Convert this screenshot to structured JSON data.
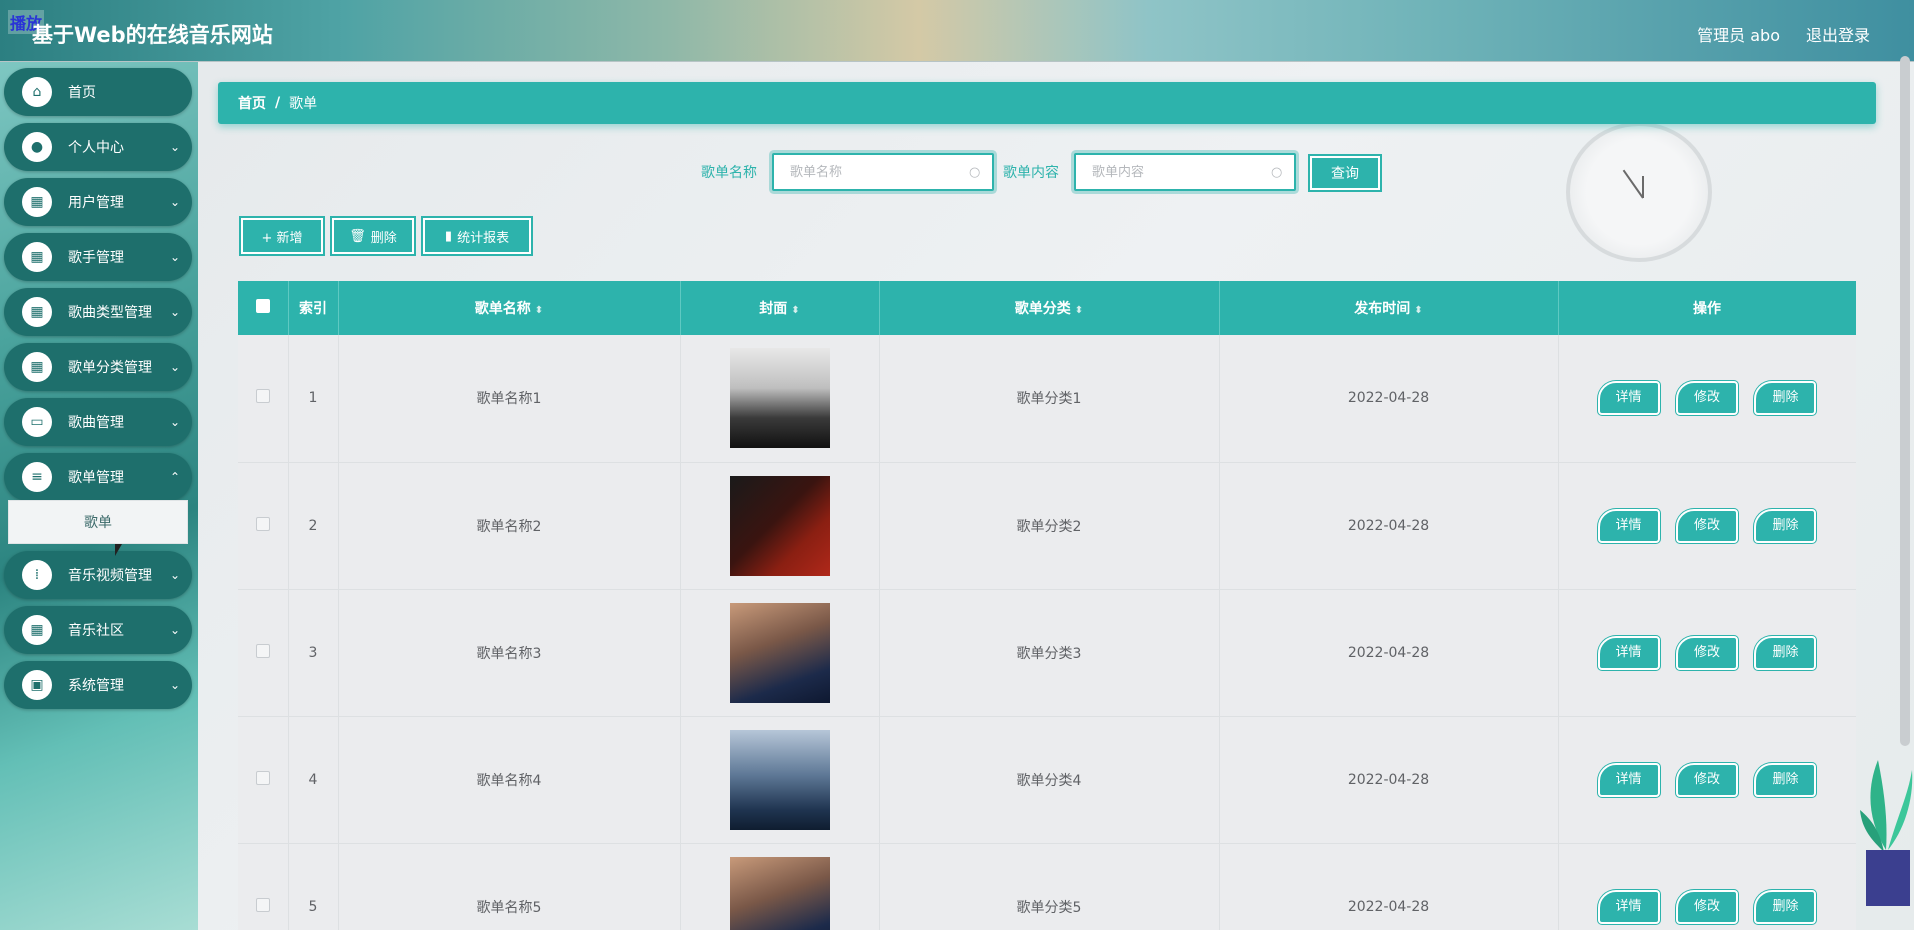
{
  "header": {
    "watermark": "播放",
    "app_title": "基于Web的在线音乐网站",
    "admin_label": "管理员 abo",
    "logout_label": "退出登录"
  },
  "sidebar": {
    "items": [
      {
        "label": "首页",
        "icon": "home-icon",
        "glyph": "⌂",
        "has_arrow": false
      },
      {
        "label": "个人中心",
        "icon": "user-icon",
        "glyph": "●",
        "has_arrow": true
      },
      {
        "label": "用户管理",
        "icon": "grid-icon",
        "glyph": "▦",
        "has_arrow": true
      },
      {
        "label": "歌手管理",
        "icon": "grid-icon",
        "glyph": "▦",
        "has_arrow": true
      },
      {
        "label": "歌曲类型管理",
        "icon": "grid-icon",
        "glyph": "▦",
        "has_arrow": true
      },
      {
        "label": "歌单分类管理",
        "icon": "grid-icon",
        "glyph": "▦",
        "has_arrow": true
      },
      {
        "label": "歌曲管理",
        "icon": "monitor-icon",
        "glyph": "▭",
        "has_arrow": true
      },
      {
        "label": "歌单管理",
        "icon": "list-icon",
        "glyph": "≡",
        "has_arrow": true
      },
      {
        "label": "音乐视频管理",
        "icon": "apps-icon",
        "glyph": "⁞",
        "has_arrow": true
      },
      {
        "label": "音乐社区",
        "icon": "grid-icon",
        "glyph": "▦",
        "has_arrow": true
      },
      {
        "label": "系统管理",
        "icon": "briefcase-icon",
        "glyph": "▣",
        "has_arrow": true
      }
    ],
    "submenu_active": "歌单"
  },
  "breadcrumb": {
    "home": "首页",
    "separator": "/",
    "current": "歌单"
  },
  "search": {
    "name_label": "歌单名称",
    "name_placeholder": "歌单名称",
    "content_label": "歌单内容",
    "content_placeholder": "歌单内容",
    "query_button": "查询"
  },
  "toolbar": {
    "add_label": "+ 新增",
    "delete_label": "删除",
    "stats_label": "统计报表"
  },
  "table": {
    "columns": [
      "索引",
      "歌单名称",
      "封面",
      "歌单分类",
      "发布时间",
      "操作"
    ],
    "rows": [
      {
        "index": "1",
        "name": "歌单名称1",
        "category": "歌单分类1",
        "date": "2022-04-28"
      },
      {
        "index": "2",
        "name": "歌单名称2",
        "category": "歌单分类2",
        "date": "2022-04-28"
      },
      {
        "index": "3",
        "name": "歌单名称3",
        "category": "歌单分类3",
        "date": "2022-04-28"
      },
      {
        "index": "4",
        "name": "歌单名称4",
        "category": "歌单分类4",
        "date": "2022-04-28"
      },
      {
        "index": "5",
        "name": "歌单名称5",
        "category": "歌单分类5",
        "date": "2022-04-28"
      }
    ],
    "actions": {
      "detail": "详情",
      "edit": "修改",
      "delete": "删除"
    }
  },
  "colors": {
    "accent": "#2db3ac",
    "sidebar_item": "#1e6f6c"
  }
}
